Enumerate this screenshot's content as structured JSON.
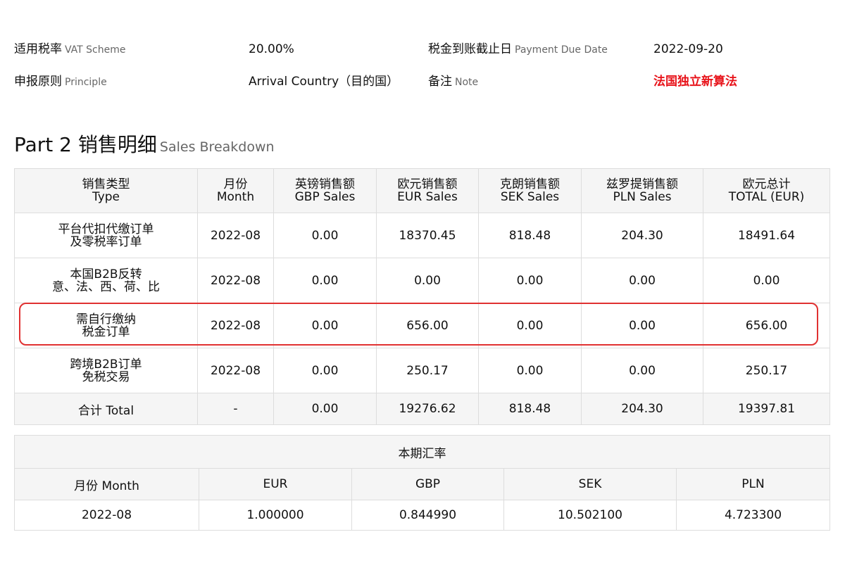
{
  "info": {
    "row1": {
      "label_cn": "适用税率",
      "label_en": "VAT Scheme",
      "value": "20.00%",
      "label2_cn": "税金到账截止日",
      "label2_en": "Payment Due Date",
      "value2": "2022-09-20"
    },
    "row2": {
      "label_cn": "申报原则",
      "label_en": "Principle",
      "value": "Arrival Country（目的国）",
      "label2_cn": "备注",
      "label2_en": "Note",
      "value2": "法国独立新算法"
    }
  },
  "section": {
    "title": "Part 2 销售明细",
    "subtitle": "Sales Breakdown"
  },
  "sales": {
    "headers": [
      {
        "cn": "销售类型",
        "en": "Type"
      },
      {
        "cn": "月份",
        "en": "Month"
      },
      {
        "cn": "英镑销售额",
        "en": "GBP Sales"
      },
      {
        "cn": "欧元销售额",
        "en": "EUR Sales"
      },
      {
        "cn": "克朗销售额",
        "en": "SEK Sales"
      },
      {
        "cn": "兹罗提销售额",
        "en": "PLN Sales"
      },
      {
        "cn": "欧元总计",
        "en": "TOTAL (EUR)"
      }
    ],
    "rows": [
      {
        "type_line1": "平台代扣代缴订单",
        "type_line2": "及零税率订单",
        "month": "2022-08",
        "gbp": "0.00",
        "eur": "18370.45",
        "sek": "818.48",
        "pln": "204.30",
        "total": "18491.64"
      },
      {
        "type_line1": "本国B2B反转",
        "type_line2": "意、法、西、荷、比",
        "month": "2022-08",
        "gbp": "0.00",
        "eur": "0.00",
        "sek": "0.00",
        "pln": "0.00",
        "total": "0.00"
      },
      {
        "type_line1": "需自行缴纳",
        "type_line2": "税金订单",
        "month": "2022-08",
        "gbp": "0.00",
        "eur": "656.00",
        "sek": "0.00",
        "pln": "0.00",
        "total": "656.00"
      },
      {
        "type_line1": "跨境B2B订单",
        "type_line2": "免税交易",
        "month": "2022-08",
        "gbp": "0.00",
        "eur": "250.17",
        "sek": "0.00",
        "pln": "0.00",
        "total": "250.17"
      }
    ],
    "total_row": {
      "label": "合计 Total",
      "month": "-",
      "gbp": "0.00",
      "eur": "19276.62",
      "sek": "818.48",
      "pln": "204.30",
      "total": "19397.81"
    }
  },
  "rates": {
    "caption": "本期汇率",
    "headers": [
      "月份 Month",
      "EUR",
      "GBP",
      "SEK",
      "PLN"
    ],
    "row": [
      "2022-08",
      "1.000000",
      "0.844990",
      "10.502100",
      "4.723300"
    ]
  },
  "colors": {
    "highlight": "#e03131",
    "note": "#e8141b",
    "header_bg": "#f5f5f5",
    "border": "#dddddd"
  }
}
